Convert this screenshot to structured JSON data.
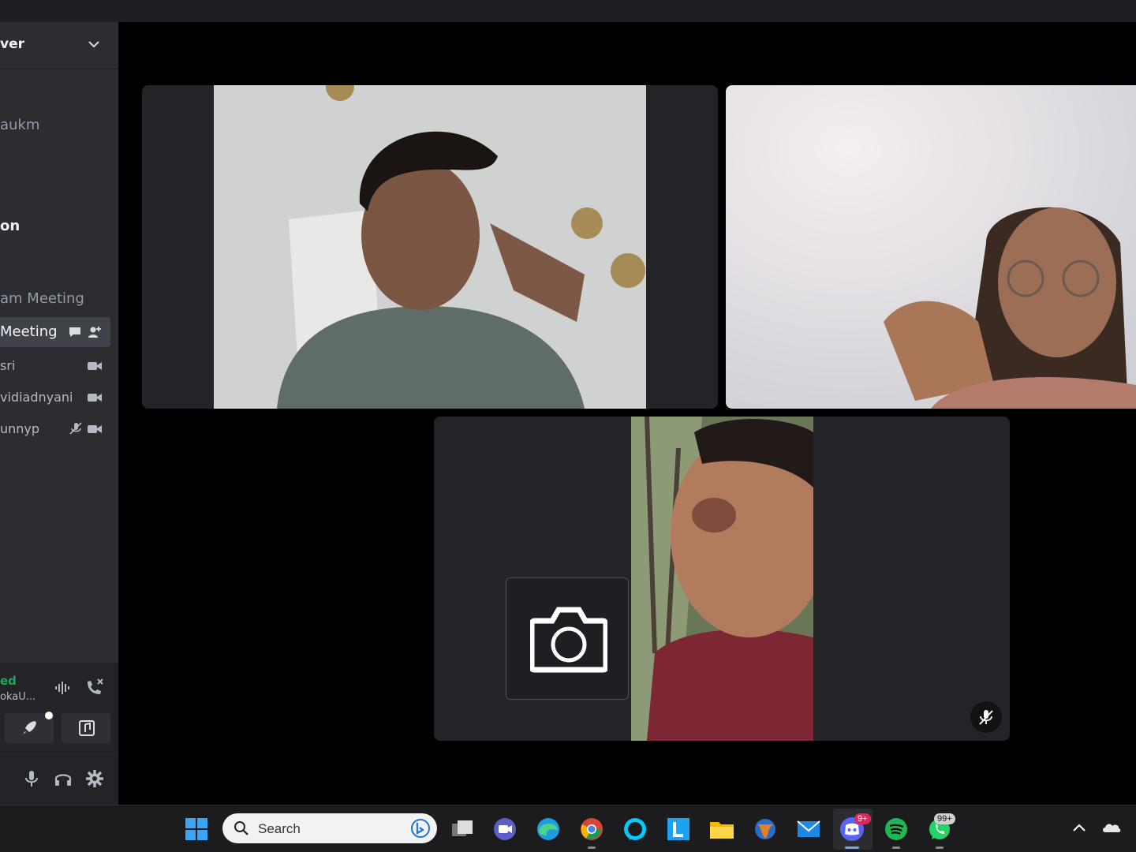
{
  "sidebar": {
    "server_name": "ver",
    "channels": [
      "aukm",
      "on",
      "am Meeting"
    ],
    "active_channel": "Meeting",
    "members": [
      "sri",
      "vidiadnyani",
      "unnyp"
    ]
  },
  "voice": {
    "status": "ed",
    "subtext": "okaU..."
  },
  "taskbar": {
    "search_placeholder": "Search",
    "discord_badge": "9+",
    "whatsapp_badge": "99+"
  },
  "icons": {
    "server_menu": "chevron-down-icon",
    "chat": "chat-icon",
    "invite": "add-person-icon",
    "camera": "video-camera-icon",
    "mic_muted": "mic-muted-icon",
    "soundboard": "waveform-icon",
    "disconnect": "disconnect-icon",
    "activities": "rocket-icon",
    "music": "music-icon",
    "mic": "mic-icon",
    "headset": "headset-icon",
    "settings": "gear-icon"
  },
  "colors": {
    "sidebar_bg": "#2b2d31",
    "voice_connected": "#23a55a",
    "tile_bg": "#232428",
    "active_channel_bg": "#404249"
  }
}
